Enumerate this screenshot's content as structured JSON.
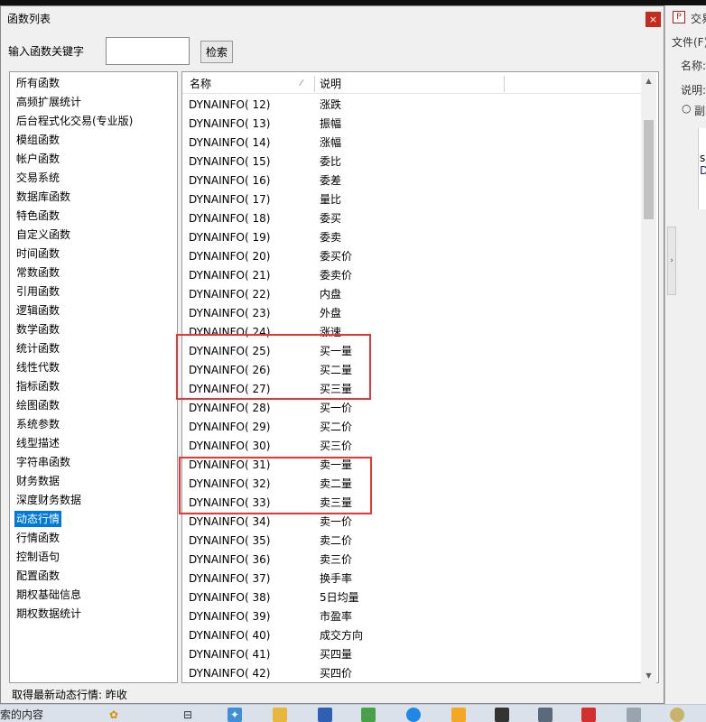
{
  "dialog": {
    "title": "函数列表",
    "close_glyph": "×",
    "keyword_label": "输入函数关键字",
    "keyword_value": "",
    "search_label": "检索"
  },
  "categories": [
    "所有函数",
    "高频扩展统计",
    "后台程式化交易(专业版)",
    "模组函数",
    "帐户函数",
    "交易系统",
    "数据库函数",
    "特色函数",
    "自定义函数",
    "时间函数",
    "常数函数",
    "引用函数",
    "逻辑函数",
    "数学函数",
    "统计函数",
    "线性代数",
    "指标函数",
    "绘图函数",
    "系统参数",
    "线型描述",
    "字符串函数",
    "财务数据",
    "深度财务数据",
    "动态行情",
    "行情函数",
    "控制语句",
    "配置函数",
    "期权基础信息",
    "期权数据统计"
  ],
  "selected_category": "动态行情",
  "table": {
    "col_name": "名称",
    "col_desc": "说明",
    "rows": [
      [
        "DYNAINFO( 12)",
        "涨跌"
      ],
      [
        "DYNAINFO( 13)",
        "振幅"
      ],
      [
        "DYNAINFO( 14)",
        "涨幅"
      ],
      [
        "DYNAINFO( 15)",
        "委比"
      ],
      [
        "DYNAINFO( 16)",
        "委差"
      ],
      [
        "DYNAINFO( 17)",
        "量比"
      ],
      [
        "DYNAINFO( 18)",
        "委买"
      ],
      [
        "DYNAINFO( 19)",
        "委卖"
      ],
      [
        "DYNAINFO( 20)",
        "委买价"
      ],
      [
        "DYNAINFO( 21)",
        "委卖价"
      ],
      [
        "DYNAINFO( 22)",
        "内盘"
      ],
      [
        "DYNAINFO( 23)",
        "外盘"
      ],
      [
        "DYNAINFO( 24)",
        "涨速"
      ],
      [
        "DYNAINFO( 25)",
        "买一量"
      ],
      [
        "DYNAINFO( 26)",
        "买二量"
      ],
      [
        "DYNAINFO( 27)",
        "买三量"
      ],
      [
        "DYNAINFO( 28)",
        "买一价"
      ],
      [
        "DYNAINFO( 29)",
        "买二价"
      ],
      [
        "DYNAINFO( 30)",
        "买三价"
      ],
      [
        "DYNAINFO( 31)",
        "卖一量"
      ],
      [
        "DYNAINFO( 32)",
        "卖二量"
      ],
      [
        "DYNAINFO( 33)",
        "卖三量"
      ],
      [
        "DYNAINFO( 34)",
        "卖一价"
      ],
      [
        "DYNAINFO( 35)",
        "卖二价"
      ],
      [
        "DYNAINFO( 36)",
        "卖三价"
      ],
      [
        "DYNAINFO( 37)",
        "换手率"
      ],
      [
        "DYNAINFO( 38)",
        "5日均量"
      ],
      [
        "DYNAINFO( 39)",
        "市盈率"
      ],
      [
        "DYNAINFO( 40)",
        "成交方向"
      ],
      [
        "DYNAINFO( 41)",
        "买四量"
      ],
      [
        "DYNAINFO( 42)",
        "买四价"
      ]
    ]
  },
  "status_text": "取得最新动态行情: 昨收",
  "right_window": {
    "title": "交易",
    "menu_file": "文件(F)",
    "label_name": "名称:",
    "label_desc": "说明:",
    "radio_label": "副",
    "code_line1": "s",
    "code_line2": "D"
  },
  "taskbar": {
    "search_text": "索的内容"
  },
  "colors": {
    "selection": "#0078d7",
    "highlight_box": "#e53935",
    "close_button": "#c42b1c"
  }
}
